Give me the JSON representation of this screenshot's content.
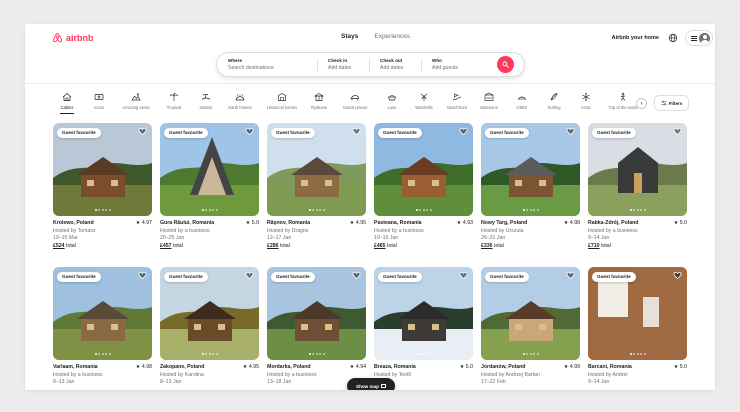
{
  "brand": {
    "name": "airbnb",
    "color": "#ff385c"
  },
  "header": {
    "tabs": [
      {
        "label": "Stays",
        "active": true
      },
      {
        "label": "Experiences",
        "active": false
      }
    ],
    "host_link": "Airbnb your home",
    "globe_icon": "globe-icon",
    "menu_icon": "hamburger-menu-icon",
    "avatar_icon": "user-avatar-icon"
  },
  "search": {
    "where": {
      "label": "Where",
      "placeholder": "Search destinations"
    },
    "check_in": {
      "label": "Check in",
      "placeholder": "Add dates"
    },
    "check_out": {
      "label": "Check out",
      "placeholder": "Add dates"
    },
    "who": {
      "label": "Who",
      "placeholder": "Add guests"
    },
    "button_icon": "search-icon"
  },
  "categories": [
    {
      "label": "Cabins",
      "icon": "cabin-icon",
      "active": true
    },
    {
      "label": "Icons",
      "icon": "icons-icon",
      "active": false
    },
    {
      "label": "Amazing views",
      "icon": "amazing-views-icon",
      "active": false
    },
    {
      "label": "Tropical",
      "icon": "tropical-icon",
      "active": false
    },
    {
      "label": "Islands",
      "icon": "islands-icon",
      "active": false
    },
    {
      "label": "Earth homes",
      "icon": "earth-homes-icon",
      "active": false
    },
    {
      "label": "Historical homes",
      "icon": "historical-homes-icon",
      "active": false
    },
    {
      "label": "Ryokans",
      "icon": "ryokans-icon",
      "active": false
    },
    {
      "label": "Grand pianos",
      "icon": "grand-pianos-icon",
      "active": false
    },
    {
      "label": "Luxe",
      "icon": "luxe-icon",
      "active": false
    },
    {
      "label": "Windmills",
      "icon": "windmills-icon",
      "active": false
    },
    {
      "label": "Beachfront",
      "icon": "beachfront-icon",
      "active": false
    },
    {
      "label": "Mansions",
      "icon": "mansions-icon",
      "active": false
    },
    {
      "label": "OMG!",
      "icon": "omg-icon",
      "active": false
    },
    {
      "label": "Surfing",
      "icon": "surfing-icon",
      "active": false
    },
    {
      "label": "Arctic",
      "icon": "arctic-icon",
      "active": false
    },
    {
      "label": "Top of the world",
      "icon": "top-of-the-world-icon",
      "active": false
    }
  ],
  "filters_label": "Filters",
  "show_map_label": "Show map",
  "listings": [
    {
      "title": "Krolewo, Poland",
      "rating": "★ 4.97",
      "host": "Hosted by Tomasz",
      "dates": "10–15 Mar",
      "price": "£524",
      "price_label": "total",
      "badge": "Guest favourite"
    },
    {
      "title": "Gura Râului, Romania",
      "rating": "★ 5.0",
      "host": "Hosted by a business",
      "dates": "20–25 Jan",
      "price": "£457",
      "price_label": "total",
      "badge": "Guest favourite"
    },
    {
      "title": "Râşnov, Romania",
      "rating": "★ 4.95",
      "host": "Hosted by Dragos",
      "dates": "12–17 Jan",
      "price": "£286",
      "price_label": "total",
      "badge": "Guest favourite"
    },
    {
      "title": "Pasteana, Romania",
      "rating": "★ 4.93",
      "host": "Hosted by a business",
      "dates": "10–15 Jan",
      "price": "£465",
      "price_label": "total",
      "badge": "Guest favourite"
    },
    {
      "title": "Nowy Targ, Poland",
      "rating": "★ 4.98",
      "host": "Hosted by Urszula",
      "dates": "26–31 Jan",
      "price": "£336",
      "price_label": "total",
      "badge": "Guest favourite"
    },
    {
      "title": "Rabka-Zdrój, Poland",
      "rating": "★ 5.0",
      "host": "Hosted by a business",
      "dates": "9–14 Jan",
      "price": "£710",
      "price_label": "total",
      "badge": "Guest favourite"
    },
    {
      "title": "Varlaam, Romania",
      "rating": "★ 4.98",
      "host": "Hosted by a business",
      "dates": "8–13 Jan",
      "price": "",
      "price_label": "",
      "badge": "Guest favourite"
    },
    {
      "title": "Zakopane, Poland",
      "rating": "★ 4.95",
      "host": "Hosted by Karolina",
      "dates": "8–13 Jan",
      "price": "",
      "price_label": "",
      "badge": "Guest favourite"
    },
    {
      "title": "Mordarka, Poland",
      "rating": "★ 4.94",
      "host": "Hosted by a business",
      "dates": "13–18 Jan",
      "price": "",
      "price_label": "",
      "badge": "Guest favourite"
    },
    {
      "title": "Breaza, Romania",
      "rating": "★ 5.0",
      "host": "Hosted by Teofil",
      "dates": "",
      "price": "",
      "price_label": "",
      "badge": "Guest favourite"
    },
    {
      "title": "Jordanów, Poland",
      "rating": "★ 4.99",
      "host": "Hosted by Andrzej Bartan",
      "dates": "17–22 Feb",
      "price": "",
      "price_label": "",
      "badge": "Guest favourite"
    },
    {
      "title": "Barcani, Romania",
      "rating": "★ 5.0",
      "host": "Hosted by Andrei",
      "dates": "9–14 Jan",
      "price": "",
      "price_label": "",
      "badge": "Guest favourite"
    }
  ]
}
